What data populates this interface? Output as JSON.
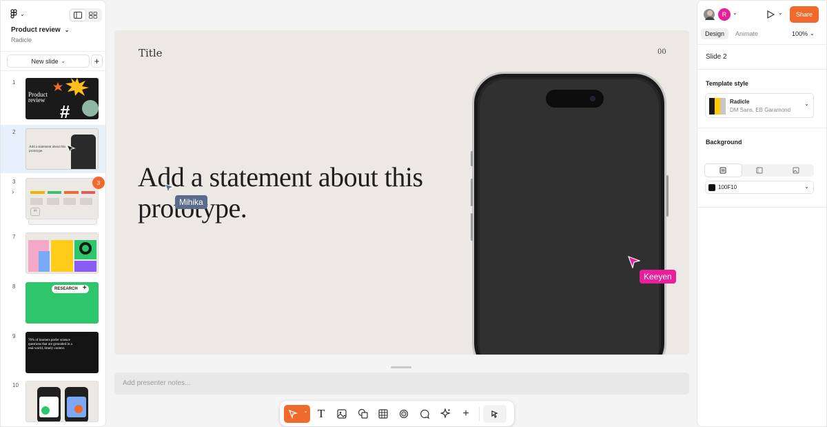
{
  "app": {
    "file_name": "Product review",
    "team": "Radicle"
  },
  "left_panel": {
    "new_slide_label": "New slide",
    "slides": [
      {
        "num": "1",
        "text": "Product review"
      },
      {
        "num": "2",
        "text": "Add a statement about this prototype."
      },
      {
        "num": "3",
        "badge": "3"
      },
      {
        "num": "7"
      },
      {
        "num": "8",
        "text": "RESEARCH"
      },
      {
        "num": "9",
        "text": "76% of learners prefer science questions that are grounded in a real-world, timely context."
      },
      {
        "num": "10"
      }
    ]
  },
  "slide": {
    "title": "Title",
    "number": "00",
    "statement": "Add a statement about this prototype."
  },
  "cursors": [
    {
      "name": "Mihika",
      "color": "#5b6b8c"
    },
    {
      "name": "Keeyen",
      "color": "#e91e9b"
    }
  ],
  "notes_placeholder": "Add presenter notes...",
  "right_panel": {
    "avatar_letter": "R",
    "share_label": "Share",
    "tabs": [
      "Design",
      "Animate"
    ],
    "zoom": "100%",
    "slide_name": "Slide 2",
    "template_heading": "Template style",
    "template_name": "Radicle",
    "template_fonts": "DM Sans, EB Garamond",
    "background_heading": "Background",
    "background_color": "100F10"
  },
  "colors": {
    "accent": "#f06a2e",
    "canvas_bg": "#ece9e5"
  }
}
